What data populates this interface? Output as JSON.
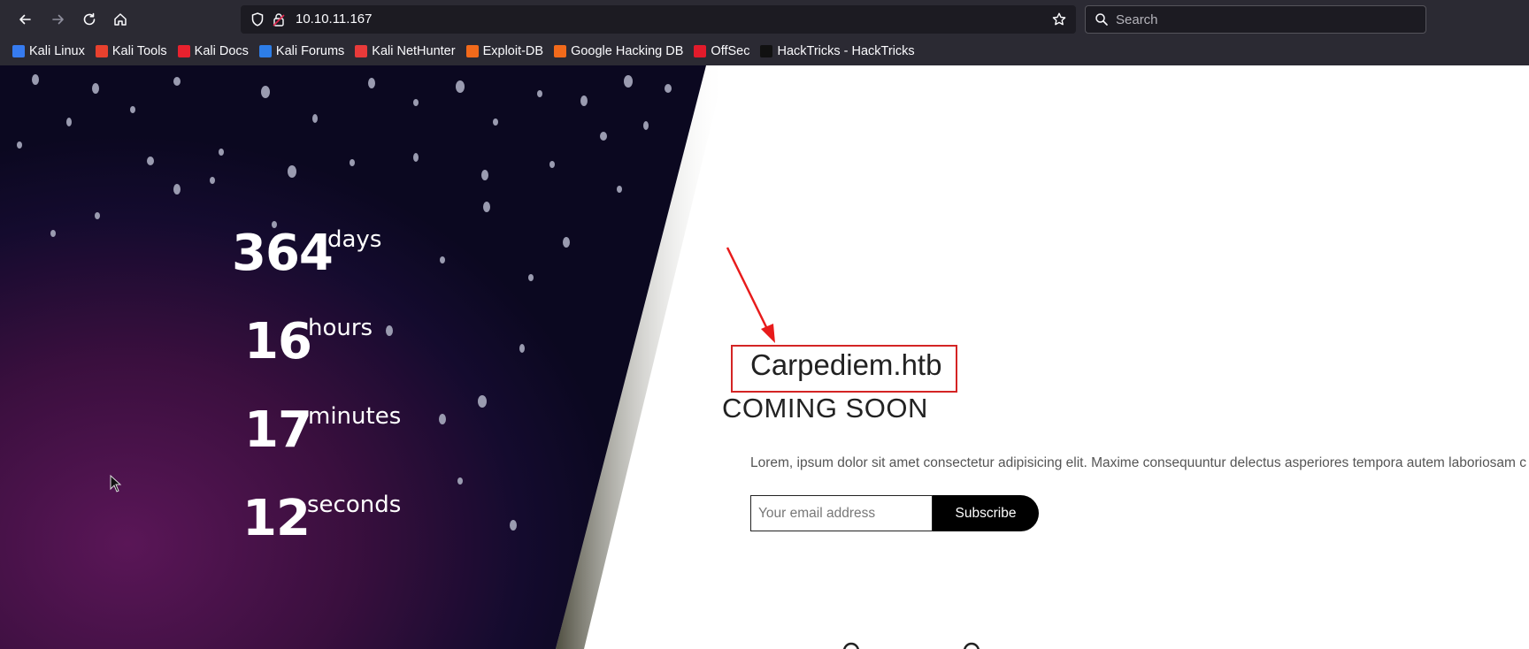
{
  "browser": {
    "url": "10.10.11.167",
    "search_placeholder": "Search",
    "bookmarks": [
      {
        "label": "Kali Linux",
        "color": "#367bf0"
      },
      {
        "label": "Kali Tools",
        "color": "#e8412e"
      },
      {
        "label": "Kali Docs",
        "color": "#e8212e"
      },
      {
        "label": "Kali Forums",
        "color": "#2d7de8"
      },
      {
        "label": "Kali NetHunter",
        "color": "#e83a3a"
      },
      {
        "label": "Exploit-DB",
        "color": "#f26a1b"
      },
      {
        "label": "Google Hacking DB",
        "color": "#f26a1b"
      },
      {
        "label": "OffSec",
        "color": "#e21b2b"
      },
      {
        "label": "HackTricks - HackTricks",
        "color": "#111111"
      }
    ]
  },
  "countdown": {
    "days": {
      "value": "364",
      "label": "days"
    },
    "hours": {
      "value": "16",
      "label": "hours"
    },
    "minutes": {
      "value": "17",
      "label": "minutes"
    },
    "seconds": {
      "value": "12",
      "label": "seconds"
    }
  },
  "main": {
    "site_title": "Carpediem.htb",
    "heading": "COMING SOON",
    "description": "Lorem, ipsum dolor sit amet consectetur adipisicing elit. Maxime consequuntur delectus asperiores tempora autem laboriosam c",
    "email_placeholder": "Your email address",
    "subscribe_label": "Subscribe"
  },
  "colors": {
    "chrome_bg": "#2b2a33",
    "annotation_red": "#d42424",
    "panel_dark": "#0b0820",
    "panel_purple": "#4a1248"
  }
}
